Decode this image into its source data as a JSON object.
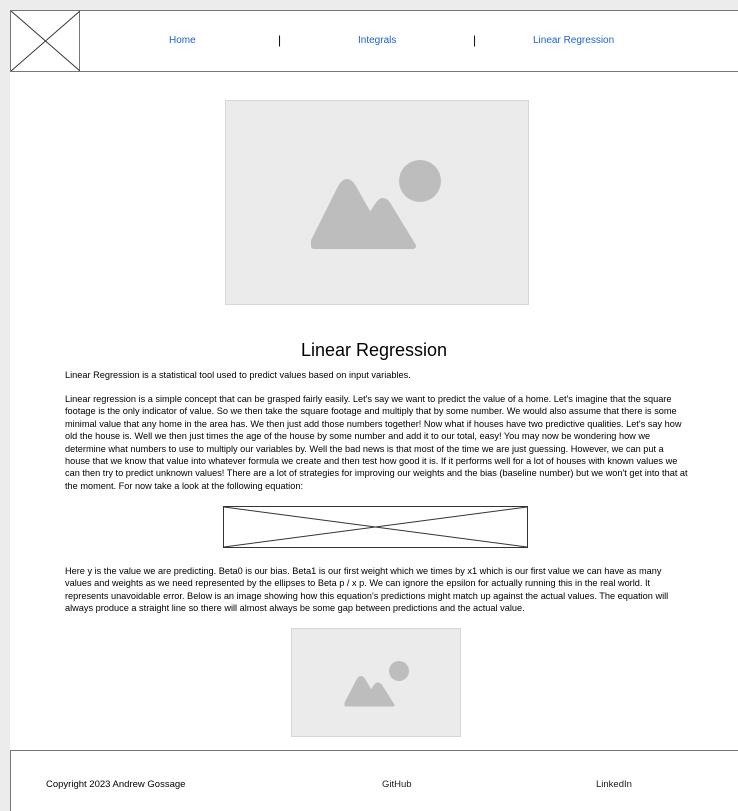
{
  "header": {
    "logo_icon": "broken-image-placeholder",
    "nav": {
      "home": "Home",
      "integrals": "Integrals",
      "linear_regression": "Linear Regression",
      "separator": "|"
    }
  },
  "hero": {
    "icon": "image-placeholder-icon"
  },
  "article": {
    "title": "Linear Regression",
    "intro": "Linear Regression is a statistical tool used to predict values based on input variables.",
    "body1": "Linear regression is a simple concept that can be grasped fairly easily. Let's say we want to predict the value of a home. Let's imagine that the square footage is the only indicator of value. So we then take the square footage and multiply that by some number. We would also assume that there is some minimal value that any home in the area has. We then just add those numbers together! Now what if houses have two predictive qualities. Let's say how old the house is. Well we then just times the age of the house by some number and add it to our total, easy! You may now be wondering how we determine what numbers to use to multiply our variables by. Well the bad news is that most of the time we are just guessing. However, we can put a house that we know that value into whatever formula we create and then test how good it is. If it performs well for a lot of houses with known values we can then try to predict unknown values! There are a lot of strategies for improving our weights and the bias (baseline number) but we won't get into that at the moment. For now take a look at the following equation:",
    "equation_icon": "broken-image-placeholder",
    "body2": "Here y is the value we are predicting. Beta0 is our bias. Beta1 is our first weight which we times by x1 which is our first value we can have as many values and weights as we need represented by the ellipses to Beta p / x p. We can ignore the epsilon for actually running this in the real world. It represents unavoidable error. Below is an image showing how this equation's predictions might match up against the actual values. The equation will always produce a straight line so there will almost always be some gap between predictions and the actual value.",
    "figure_icon": "image-placeholder-icon"
  },
  "footer": {
    "copyright": "Copyright 2023 Andrew Gossage",
    "github": "GitHub",
    "linkedin": "LinkedIn"
  },
  "colors": {
    "link": "#1a63d6",
    "placeholder_bg": "#ebebeb",
    "placeholder_icon": "#bdbdbd"
  }
}
